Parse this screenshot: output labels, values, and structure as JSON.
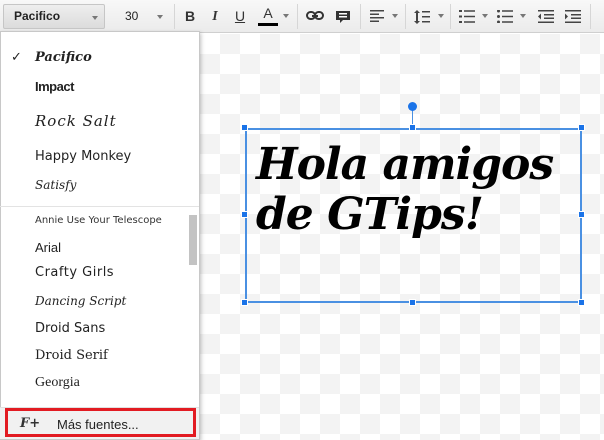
{
  "toolbar": {
    "font_name": "Pacifico",
    "font_size": "30",
    "bold": "B",
    "italic": "I",
    "underline": "U",
    "text_color": "A"
  },
  "font_menu": {
    "recent": [
      {
        "label": "Pacifico",
        "checked": true
      },
      {
        "label": "Impact"
      },
      {
        "label": "Rock Salt"
      },
      {
        "label": "Happy Monkey"
      },
      {
        "label": "Satisfy"
      }
    ],
    "all": [
      {
        "label": "Annie Use Your Telescope"
      },
      {
        "label": "Arial"
      },
      {
        "label": "Crafty Girls"
      },
      {
        "label": "Dancing Script"
      },
      {
        "label": "Droid Sans"
      },
      {
        "label": "Droid Serif"
      },
      {
        "label": "Georgia"
      }
    ],
    "more_icon": "F+",
    "more_label": "Más fuentes..."
  },
  "canvas": {
    "text": "Hola amigos de GTips!"
  },
  "colors": {
    "selection": "#4a90e2",
    "highlight": "#e21b22"
  }
}
